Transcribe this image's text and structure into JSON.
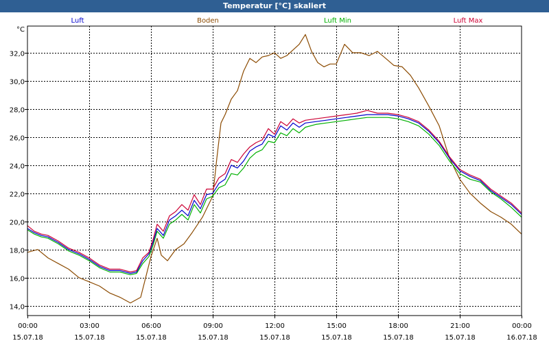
{
  "window": {
    "title": "Temperatur [°C] skaliert"
  },
  "colors": {
    "Luft": "#0000cc",
    "Boden": "#8b4a00",
    "Luft Min": "#00b000",
    "Luft Max": "#cc0033"
  },
  "chart_data": {
    "type": "line",
    "title": "Temperatur [°C] skaliert",
    "ylabel": "°C",
    "xlabel": "",
    "ylim": [
      13.3,
      33.9
    ],
    "xlim": [
      0,
      24
    ],
    "grid": true,
    "legend": "top",
    "yticks": [
      "14,0",
      "16,0",
      "18,0",
      "20,0",
      "22,0",
      "24,0",
      "26,0",
      "28,0",
      "30,0",
      "32,0"
    ],
    "xticks": [
      {
        "time": "00:00",
        "date": "15.07.18"
      },
      {
        "time": "03:00",
        "date": "15.07.18"
      },
      {
        "time": "06:00",
        "date": "15.07.18"
      },
      {
        "time": "09:00",
        "date": "15.07.18"
      },
      {
        "time": "12:00",
        "date": "15.07.18"
      },
      {
        "time": "15:00",
        "date": "15.07.18"
      },
      {
        "time": "18:00",
        "date": "15.07.18"
      },
      {
        "time": "21:00",
        "date": "15.07.18"
      },
      {
        "time": "00:00",
        "date": "16.07.18"
      }
    ],
    "series": [
      {
        "name": "Luft",
        "x": [
          0,
          0.33,
          0.67,
          1,
          1.5,
          2,
          2.5,
          3,
          3.5,
          4,
          4.5,
          5,
          5.3,
          5.6,
          5.9,
          6.1,
          6.3,
          6.6,
          6.9,
          7.2,
          7.5,
          7.8,
          8.1,
          8.4,
          8.7,
          9,
          9.3,
          9.6,
          9.9,
          10.2,
          10.5,
          10.8,
          11.1,
          11.4,
          11.7,
          12,
          12.3,
          12.6,
          12.9,
          13.2,
          13.5,
          14,
          14.5,
          15,
          15.5,
          16,
          16.5,
          17,
          17.5,
          18,
          18.5,
          19,
          19.5,
          20,
          20.5,
          21,
          21.5,
          22,
          22.5,
          23,
          23.5,
          24
        ],
        "y": [
          19.5,
          19.2,
          19.0,
          18.9,
          18.5,
          18.0,
          17.7,
          17.3,
          16.8,
          16.5,
          16.5,
          16.3,
          16.4,
          17.2,
          17.7,
          18.5,
          19.5,
          19.0,
          20.1,
          20.4,
          20.8,
          20.4,
          21.5,
          20.9,
          21.9,
          22.0,
          22.7,
          23.0,
          24.0,
          23.8,
          24.3,
          25.0,
          25.3,
          25.5,
          26.2,
          26.0,
          26.8,
          26.5,
          27.0,
          26.7,
          27.0,
          27.1,
          27.2,
          27.3,
          27.4,
          27.5,
          27.6,
          27.6,
          27.6,
          27.5,
          27.3,
          27.0,
          26.4,
          25.6,
          24.5,
          23.6,
          23.2,
          22.9,
          22.2,
          21.7,
          21.2,
          20.5
        ]
      },
      {
        "name": "Boden",
        "x": [
          0,
          0.5,
          1,
          1.5,
          2,
          2.5,
          3,
          3.5,
          4,
          4.5,
          5,
          5.5,
          6,
          6.3,
          6.5,
          6.8,
          7.2,
          7.6,
          8,
          8.5,
          9,
          9.2,
          9.4,
          9.6,
          9.9,
          10.2,
          10.5,
          10.8,
          11.1,
          11.4,
          11.7,
          12,
          12.3,
          12.6,
          12.9,
          13.2,
          13.5,
          13.8,
          14.1,
          14.4,
          14.7,
          15,
          15.4,
          15.8,
          16.2,
          16.6,
          17,
          17.4,
          17.8,
          18.2,
          18.6,
          19,
          19.5,
          20,
          20.5,
          21,
          21.5,
          22,
          22.5,
          23,
          23.5,
          24
        ],
        "y": [
          17.8,
          18.0,
          17.4,
          17.0,
          16.6,
          16.0,
          15.7,
          15.4,
          14.9,
          14.6,
          14.2,
          14.6,
          17.5,
          18.8,
          17.6,
          17.2,
          18.0,
          18.4,
          19.2,
          20.3,
          21.8,
          24.5,
          27.0,
          27.6,
          28.7,
          29.3,
          30.7,
          31.6,
          31.3,
          31.7,
          31.8,
          32.0,
          31.6,
          31.8,
          32.2,
          32.6,
          33.3,
          32.1,
          31.3,
          31.0,
          31.2,
          31.2,
          32.6,
          32.0,
          32.0,
          31.8,
          32.1,
          31.6,
          31.1,
          31.0,
          30.4,
          29.5,
          28.2,
          26.8,
          24.5,
          23.0,
          22.0,
          21.3,
          20.7,
          20.3,
          19.8,
          19.1
        ]
      },
      {
        "name": "Luft Min",
        "x": [
          0,
          0.33,
          0.67,
          1,
          1.5,
          2,
          2.5,
          3,
          3.5,
          4,
          4.5,
          5,
          5.3,
          5.6,
          5.9,
          6.1,
          6.3,
          6.6,
          6.9,
          7.2,
          7.5,
          7.8,
          8.1,
          8.4,
          8.7,
          9,
          9.3,
          9.6,
          9.9,
          10.2,
          10.5,
          10.8,
          11.1,
          11.4,
          11.7,
          12,
          12.3,
          12.6,
          12.9,
          13.2,
          13.5,
          14,
          14.5,
          15,
          15.5,
          16,
          16.5,
          17,
          17.5,
          18,
          18.5,
          19,
          19.5,
          20,
          20.5,
          21,
          21.5,
          22,
          22.5,
          23,
          23.5,
          24
        ],
        "y": [
          19.4,
          19.1,
          18.9,
          18.8,
          18.4,
          17.9,
          17.6,
          17.2,
          16.7,
          16.4,
          16.4,
          16.2,
          16.3,
          17.0,
          17.5,
          18.3,
          19.3,
          18.8,
          19.8,
          20.1,
          20.5,
          20.1,
          21.2,
          20.6,
          21.6,
          21.8,
          22.4,
          22.6,
          23.4,
          23.3,
          23.8,
          24.5,
          24.9,
          25.1,
          25.7,
          25.6,
          26.3,
          26.1,
          26.6,
          26.3,
          26.7,
          26.9,
          27.0,
          27.1,
          27.2,
          27.3,
          27.4,
          27.4,
          27.4,
          27.3,
          27.1,
          26.8,
          26.2,
          25.4,
          24.3,
          23.4,
          23.0,
          22.8,
          22.1,
          21.6,
          21.0,
          20.3
        ]
      },
      {
        "name": "Luft Max",
        "x": [
          0,
          0.33,
          0.67,
          1,
          1.5,
          2,
          2.5,
          3,
          3.5,
          4,
          4.5,
          5,
          5.3,
          5.6,
          5.9,
          6.1,
          6.3,
          6.6,
          6.9,
          7.2,
          7.5,
          7.8,
          8.1,
          8.4,
          8.7,
          9,
          9.3,
          9.6,
          9.9,
          10.2,
          10.5,
          10.8,
          11.1,
          11.4,
          11.7,
          12,
          12.3,
          12.6,
          12.9,
          13.2,
          13.5,
          14,
          14.5,
          15,
          15.5,
          16,
          16.5,
          17,
          17.5,
          18,
          18.5,
          19,
          19.5,
          20,
          20.5,
          21,
          21.5,
          22,
          22.5,
          23,
          23.5,
          24
        ],
        "y": [
          19.7,
          19.3,
          19.1,
          19.0,
          18.6,
          18.1,
          17.8,
          17.4,
          16.9,
          16.6,
          16.6,
          16.4,
          16.5,
          17.4,
          17.8,
          18.7,
          19.8,
          19.3,
          20.4,
          20.7,
          21.2,
          20.8,
          21.9,
          21.2,
          22.3,
          22.3,
          23.1,
          23.4,
          24.4,
          24.2,
          24.8,
          25.3,
          25.6,
          25.8,
          26.6,
          26.2,
          27.1,
          26.8,
          27.3,
          27.0,
          27.2,
          27.3,
          27.4,
          27.5,
          27.6,
          27.7,
          27.9,
          27.7,
          27.7,
          27.6,
          27.4,
          27.1,
          26.5,
          25.7,
          24.6,
          23.7,
          23.3,
          23.0,
          22.3,
          21.8,
          21.3,
          20.6
        ]
      }
    ]
  }
}
